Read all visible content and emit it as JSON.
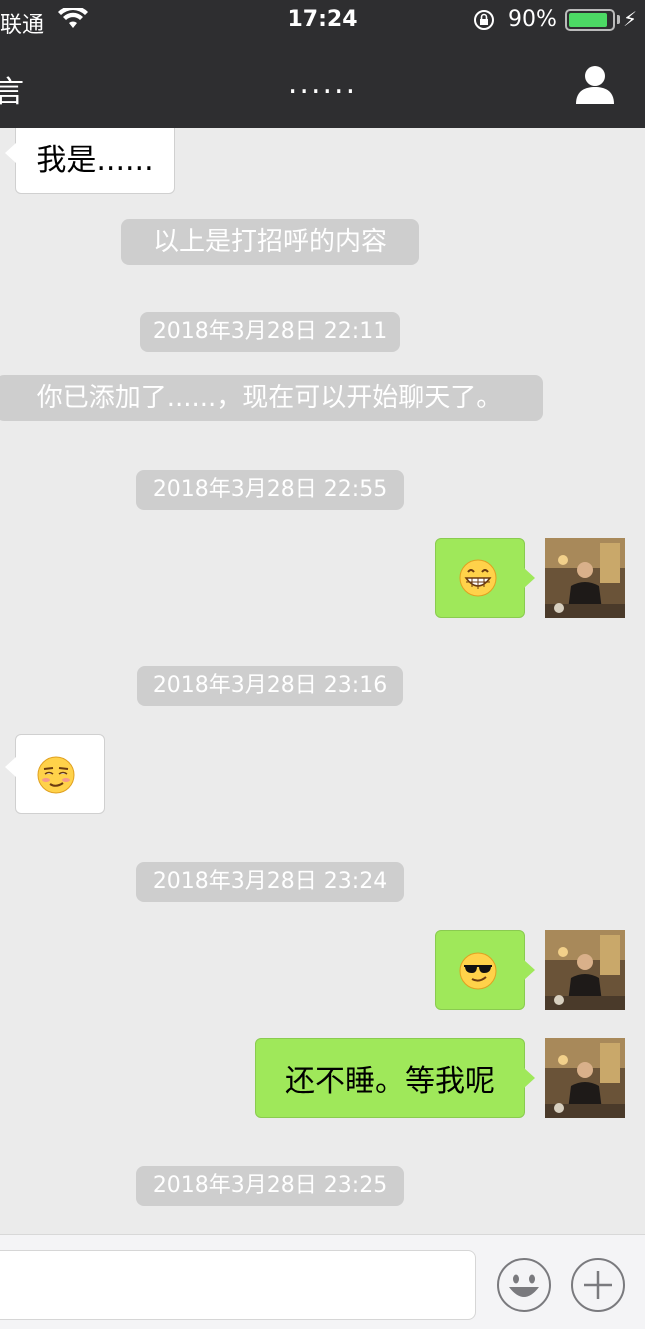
{
  "status_bar": {
    "carrier": "联通",
    "time": "17:24",
    "battery_percent": "90%",
    "battery_level": 0.9,
    "battery_color": "#4cd964"
  },
  "nav": {
    "back_label_fragment": "言",
    "title": "......",
    "profile_icon": "person-icon"
  },
  "messages": [
    {
      "type": "text_in",
      "text": "我是......"
    },
    {
      "type": "system",
      "text": "以上是打招呼的内容"
    },
    {
      "type": "timestamp",
      "text": "2018年3月28日 22:11"
    },
    {
      "type": "system",
      "text": "你已添加了......，现在可以开始聊天了。"
    },
    {
      "type": "timestamp",
      "text": "2018年3月28日 22:55"
    },
    {
      "type": "emoji_out",
      "emoji": "grinning-teeth-emoji"
    },
    {
      "type": "timestamp",
      "text": "2018年3月28日 23:16"
    },
    {
      "type": "emoji_in",
      "emoji": "smirk-emoji"
    },
    {
      "type": "timestamp",
      "text": "2018年3月28日 23:24"
    },
    {
      "type": "emoji_out",
      "emoji": "sunglasses-emoji"
    },
    {
      "type": "text_out",
      "text": "还不睡。等我呢"
    },
    {
      "type": "timestamp",
      "text": "2018年3月28日 23:25"
    }
  ],
  "colors": {
    "header_bg": "#2e2e30",
    "chat_bg": "#ebebeb",
    "outgoing_bubble": "#9fe85a",
    "incoming_bubble": "#ffffff",
    "pill_bg": "#cecece"
  },
  "input_bar": {
    "emoji_button_icon": "smiley-face-icon",
    "more_button_icon": "plus-circle-icon"
  }
}
